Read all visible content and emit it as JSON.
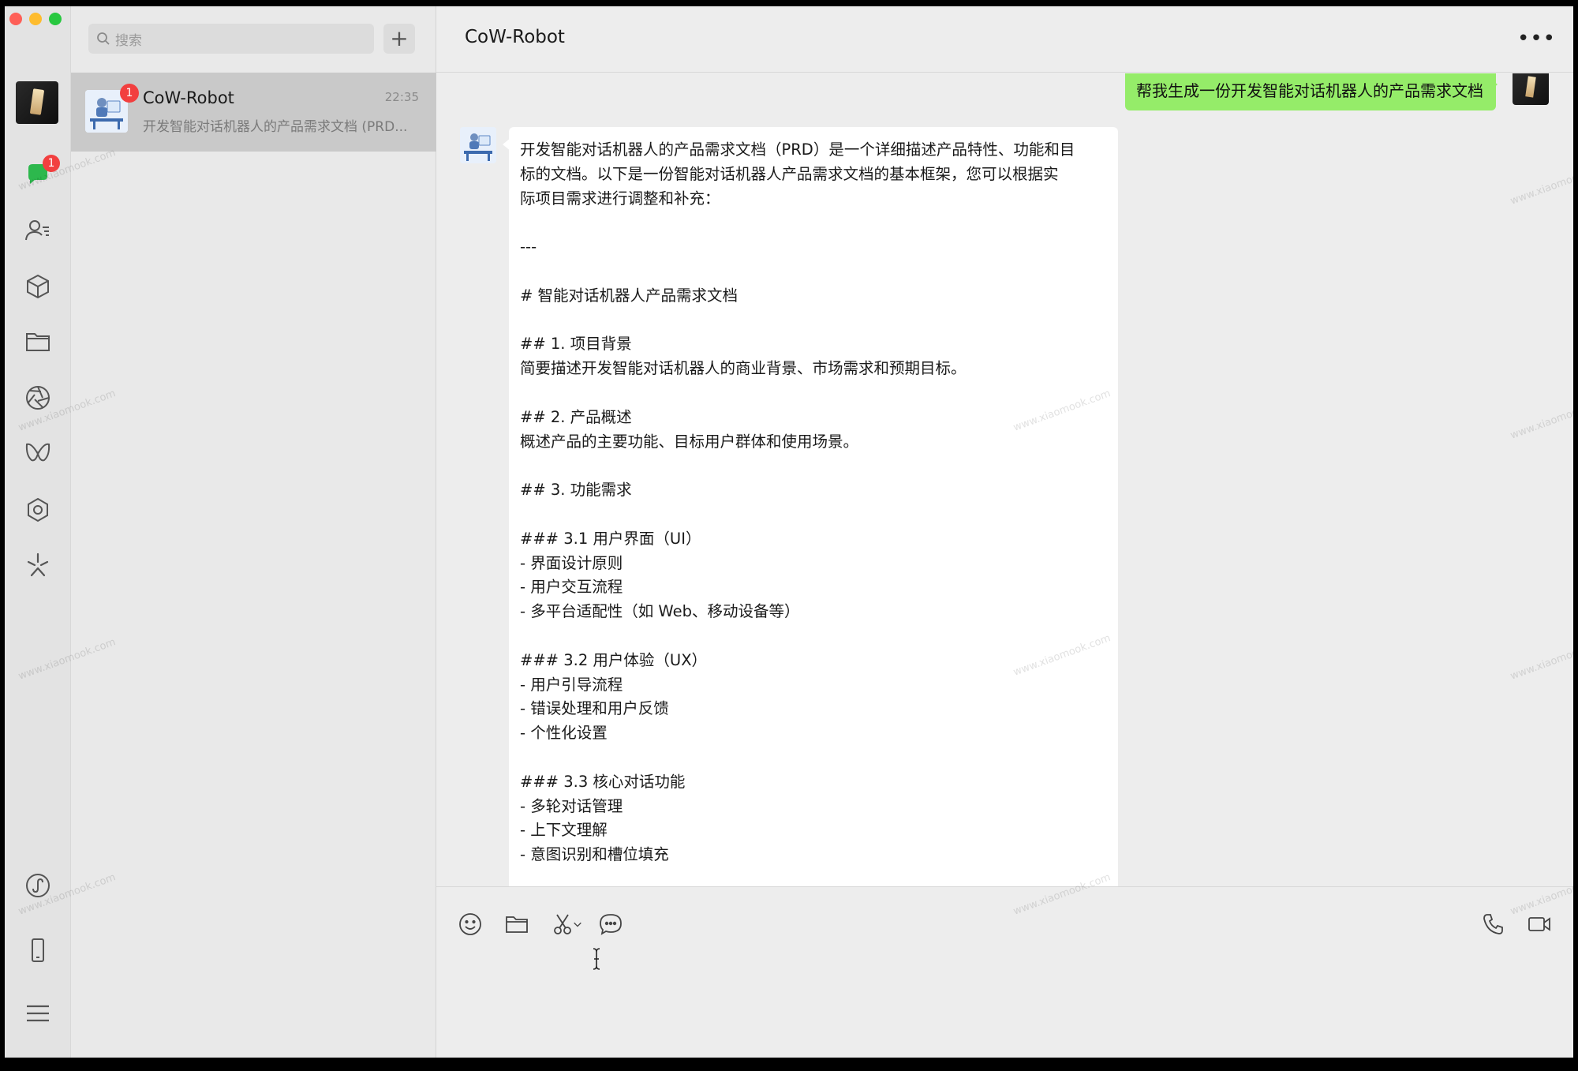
{
  "window": {
    "traffic_lights": [
      "red",
      "yellow",
      "green"
    ]
  },
  "rail": {
    "icons": [
      "chat-icon",
      "contacts-icon",
      "cube-icon",
      "folder-icon",
      "aperture-icon",
      "butterfly-icon",
      "hexagon-gear-icon",
      "sparkle-icon",
      "miniprogram-icon",
      "phone-device-icon",
      "menu-icon"
    ],
    "chat_badge": "1"
  },
  "sidebar": {
    "search_placeholder": "搜索",
    "add_label": "+",
    "conversation": {
      "name": "CoW-Robot",
      "time": "22:35",
      "preview": "开发智能对话机器人的产品需求文档 (PRD...",
      "badge": "1"
    }
  },
  "chat": {
    "title": "CoW-Robot",
    "more_label": "•••",
    "sent_message": "帮我生成一份开发智能对话机器人的产品需求文档",
    "reply_lines": [
      "开发智能对话机器人的产品需求文档（PRD）是一个详细描述产品特性、功能和目",
      "标的文档。以下是一份智能对话机器人产品需求文档的基本框架，您可以根据实",
      "际项目需求进行调整和补充：",
      "",
      "---",
      "",
      "# 智能对话机器人产品需求文档",
      "",
      "## 1. 项目背景",
      "简要描述开发智能对话机器人的商业背景、市场需求和预期目标。",
      "",
      "## 2. 产品概述",
      "概述产品的主要功能、目标用户群体和使用场景。",
      "",
      "## 3. 功能需求",
      "",
      "### 3.1 用户界面（UI）",
      "- 界面设计原则",
      "- 用户交互流程",
      "- 多平台适配性（如 Web、移动设备等）",
      "",
      "### 3.2 用户体验（UX）",
      "- 用户引导流程",
      "- 错误处理和用户反馈",
      "- 个性化设置",
      "",
      "### 3.3 核心对话功能",
      "- 多轮对话管理",
      "- 上下文理解",
      "- 意图识别和槽位填充"
    ]
  },
  "input": {
    "tools": [
      "emoji-icon",
      "folder-icon",
      "scissors-icon",
      "chat-bubble-icon",
      "phone-icon",
      "video-icon"
    ]
  },
  "watermark": "www.xiaomook.com"
}
